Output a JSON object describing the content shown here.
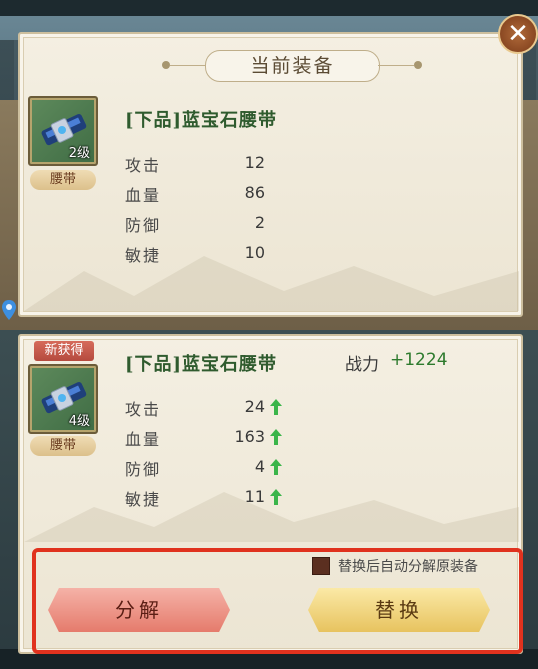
{
  "current": {
    "section_title": "当前装备",
    "item_name": "[下品]蓝宝石腰带",
    "level": "2级",
    "type": "腰带",
    "stats": [
      {
        "label": "攻击",
        "value": "12"
      },
      {
        "label": "血量",
        "value": "86"
      },
      {
        "label": "防御",
        "value": "2"
      },
      {
        "label": "敏捷",
        "value": "10"
      }
    ]
  },
  "new_item": {
    "tag": "新获得",
    "item_name": "[下品]蓝宝石腰带",
    "level": "4级",
    "type": "腰带",
    "power_label": "战力",
    "power_value": "+1224",
    "stats": [
      {
        "label": "攻击",
        "value": "24",
        "trend": "up"
      },
      {
        "label": "血量",
        "value": "163",
        "trend": "up"
      },
      {
        "label": "防御",
        "value": "4",
        "trend": "up"
      },
      {
        "label": "敏捷",
        "value": "11",
        "trend": "up"
      }
    ]
  },
  "actions": {
    "auto_decompose_label": "替换后自动分解原装备",
    "auto_decompose_checked": false,
    "decompose_label": "分解",
    "replace_label": "替换"
  },
  "icons": [
    "close-icon",
    "belt-icon",
    "arrow-up-icon",
    "map-pin-icon"
  ],
  "colors": {
    "highlight": "#e0321e",
    "positive": "#2d7a2d",
    "item_name": "#2f5b2e"
  }
}
